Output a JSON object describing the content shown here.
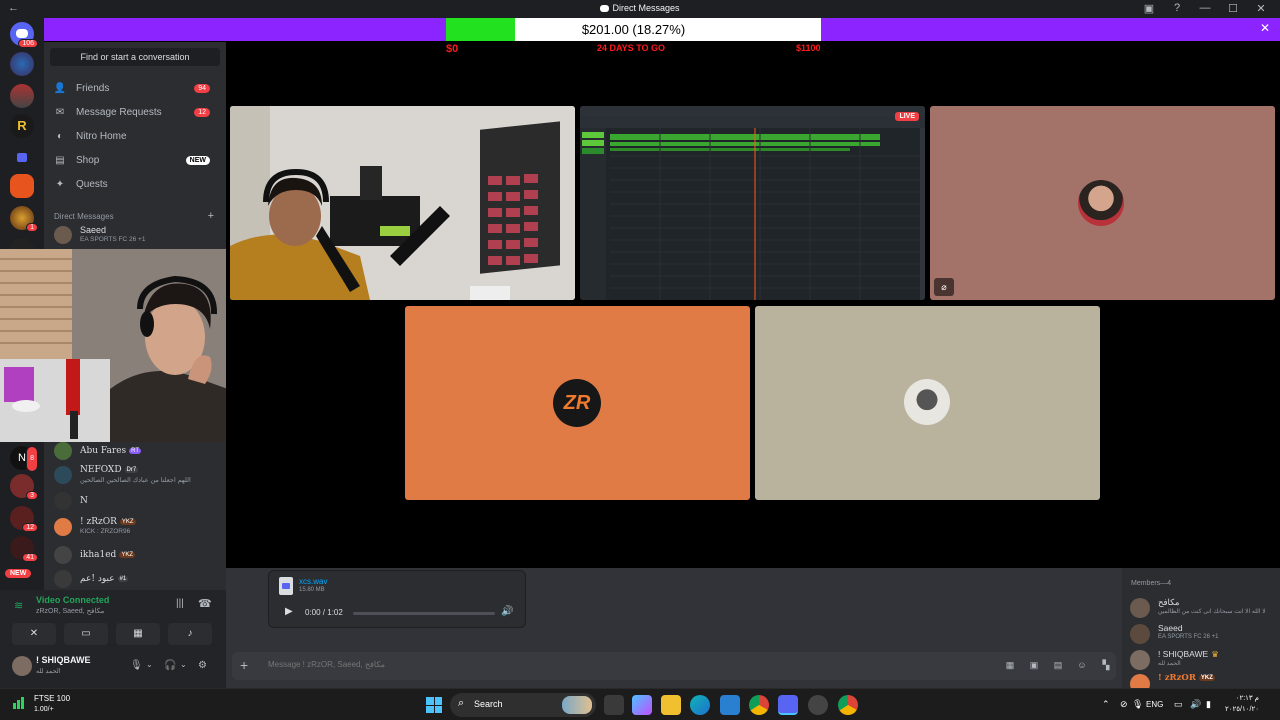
{
  "window": {
    "title": "Direct Messages"
  },
  "donation_goal": {
    "amount_text": "$201.00 (18.27%)",
    "fill_fraction": 0.1827,
    "start_label": "$0",
    "days_label": "24 DAYS TO GO",
    "target_label": "$1100"
  },
  "server_rail": {
    "home_badge": "106",
    "badges": [
      "2",
      "1",
      "8",
      "3",
      "12",
      "41"
    ],
    "new_label": "NEW"
  },
  "sidebar": {
    "search_placeholder": "Find or start a conversation",
    "nav": [
      {
        "label": "Friends",
        "badge": "94"
      },
      {
        "label": "Message Requests",
        "badge": "12"
      },
      {
        "label": "Nitro Home",
        "badge": ""
      },
      {
        "label": "Shop",
        "badge": "NEW"
      },
      {
        "label": "Quests",
        "badge": ""
      }
    ],
    "dm_header": "Direct Messages",
    "dms": [
      {
        "name": "Saeed",
        "sub": "EA SPORTS FC 26 +1",
        "tag": ""
      },
      {
        "name": "Abu Fares",
        "sub": "",
        "tag": "RT"
      },
      {
        "name": "NEFOXD",
        "sub": "اللهم اجعلنا من عبادك الصالحين الصالحين",
        "tag": "Dr7"
      },
      {
        "name": "N",
        "sub": "",
        "tag": ""
      },
      {
        "name": "! zRzOR",
        "sub": "KICK : ZRZOR96",
        "tag": "YKZ"
      },
      {
        "name": "ikha1ed",
        "sub": "",
        "tag": "YKZ"
      },
      {
        "name": "عبود !عم",
        "sub": "",
        "tag": "#1"
      }
    ]
  },
  "voice": {
    "status": "Video Connected",
    "channel": "zRzOR, Saeed, مكافح"
  },
  "user": {
    "name": "! SHIQBAWE",
    "status": "الحمد لله"
  },
  "tiles": {
    "live_label": "LIVE"
  },
  "attachment": {
    "file_name": "xcs.wav",
    "file_size": "15.80 MB",
    "time": "0:00 / 1:02",
    "progress": 0.0
  },
  "composer": {
    "placeholder": "Message ! zRzOR, Saeed, مكافح"
  },
  "members": {
    "header": "Members—4",
    "list": [
      {
        "name": "مكافح",
        "sub": "لا الله الا انت سبحانك انى كنت من الظالمين"
      },
      {
        "name": "Saeed",
        "sub": "EA SPORTS FC 26 +1"
      },
      {
        "name": "! SHIQBAWE",
        "sub": "الحمد لله"
      },
      {
        "name": "! zRzOR",
        "sub": "YKZ"
      }
    ]
  },
  "taskbar": {
    "ticker_name": "FTSE 100",
    "ticker_value": "1.00/+",
    "search_label": "Search",
    "lang": "ENG",
    "time": "م ٠٢:١٣",
    "date": "٢٠٢٥/١٠/٢٠"
  },
  "colors": {
    "goal_bar": "#8b24ff",
    "goal_fill": "#22e21f",
    "tile_orange": "#e07b45",
    "tile_tan": "#b9b29d",
    "tile_rose": "#a3736a",
    "voice_green": "#23a55a"
  }
}
